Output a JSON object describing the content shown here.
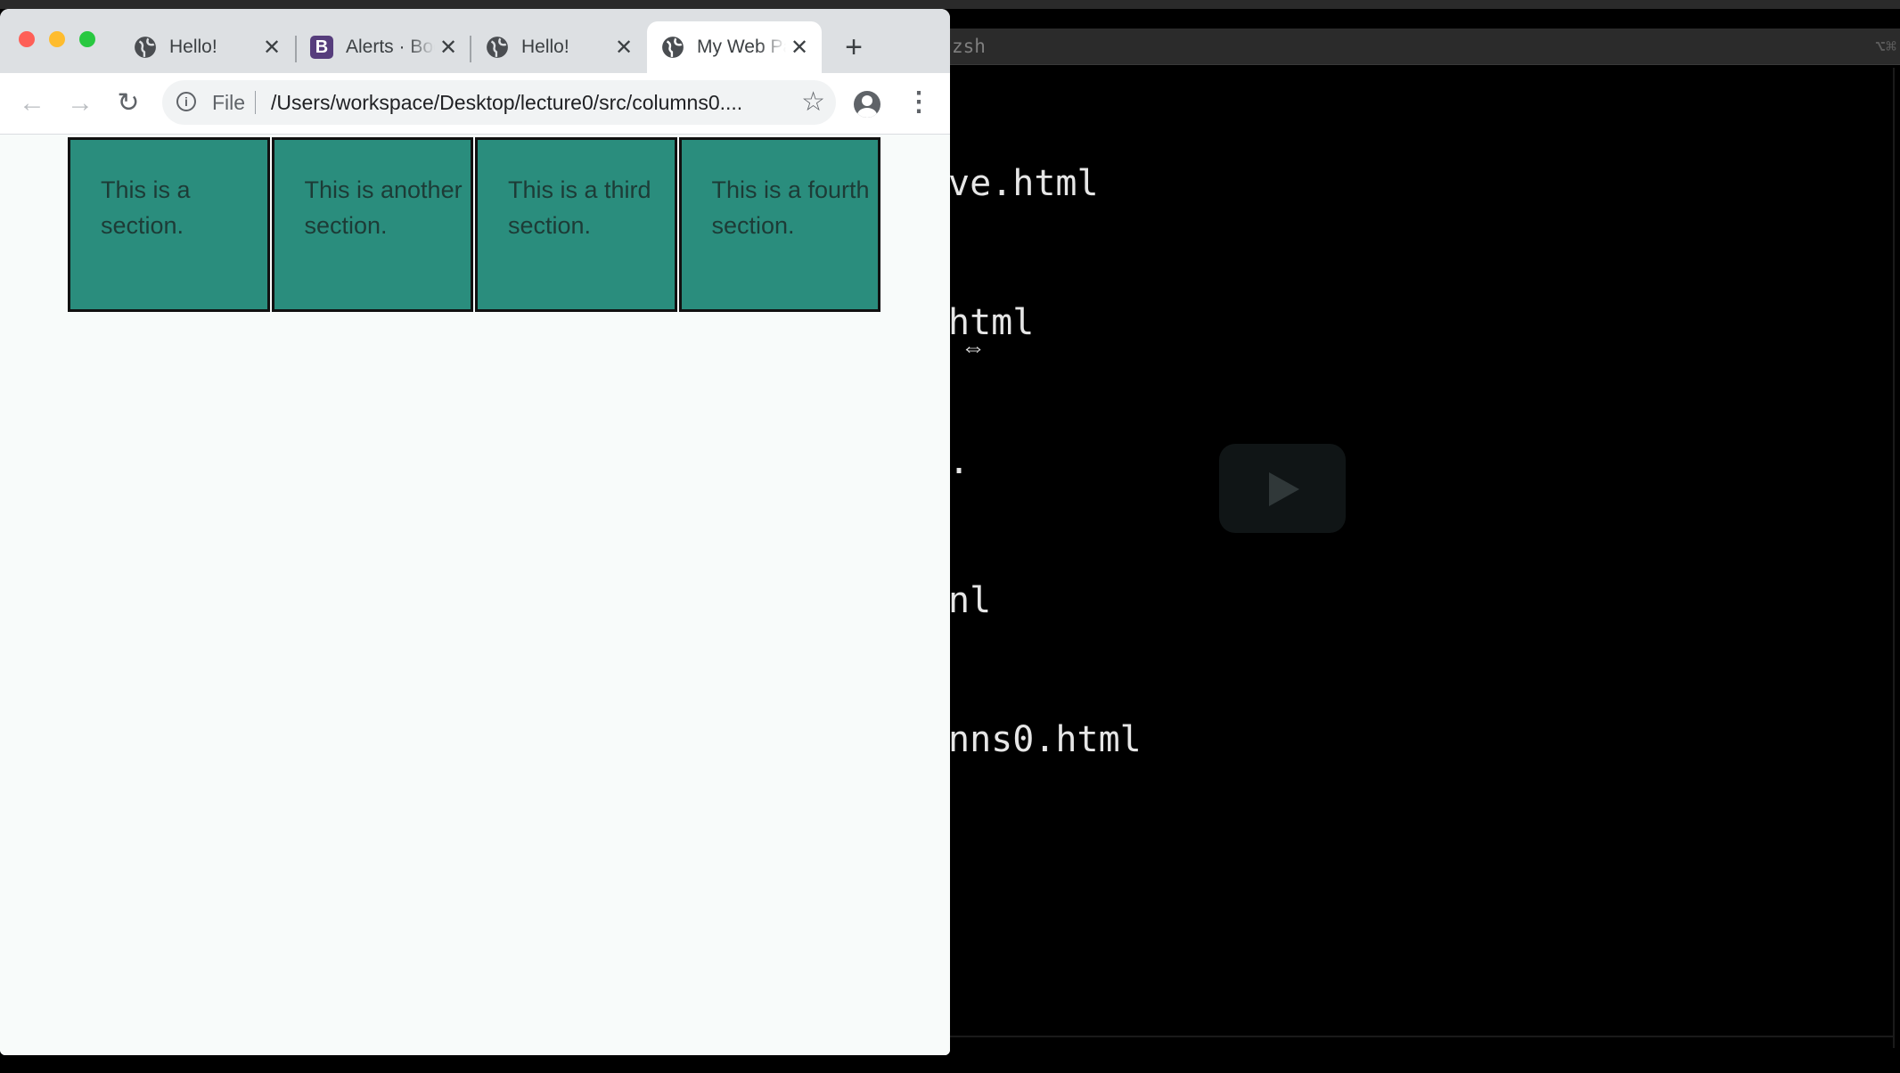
{
  "terminal": {
    "title": "zsh",
    "shortcut": "⌥⌘",
    "lines": [
      "ve.html",
      "html",
      ".",
      "nl",
      "nns0.html"
    ],
    "colors": {
      "background": "#000000",
      "text": "#e6e6e6"
    },
    "icons": {
      "resize": "resize-cursor-icon",
      "overlay": "play-button-icon"
    }
  },
  "browser": {
    "tabs": [
      {
        "title": "Hello!",
        "icon": "globe-icon",
        "active": false
      },
      {
        "title": "Alerts · Bootstrap",
        "icon": "bootstrap-icon",
        "active": false
      },
      {
        "title": "Hello!",
        "icon": "globe-icon",
        "active": false
      },
      {
        "title": "My Web Page",
        "icon": "globe-icon",
        "active": true
      }
    ],
    "toolbar": {
      "file_label": "File",
      "url": "/Users/workspace/Desktop/lecture0/src/columns0...."
    },
    "colors": {
      "tab_strip": "#dde0e3",
      "section_bg": "#2a8d7d",
      "section_border": "#111111"
    }
  },
  "page": {
    "sections": [
      "This is a section.",
      "This is another section.",
      "This is a third section.",
      "This is a fourth section."
    ]
  }
}
